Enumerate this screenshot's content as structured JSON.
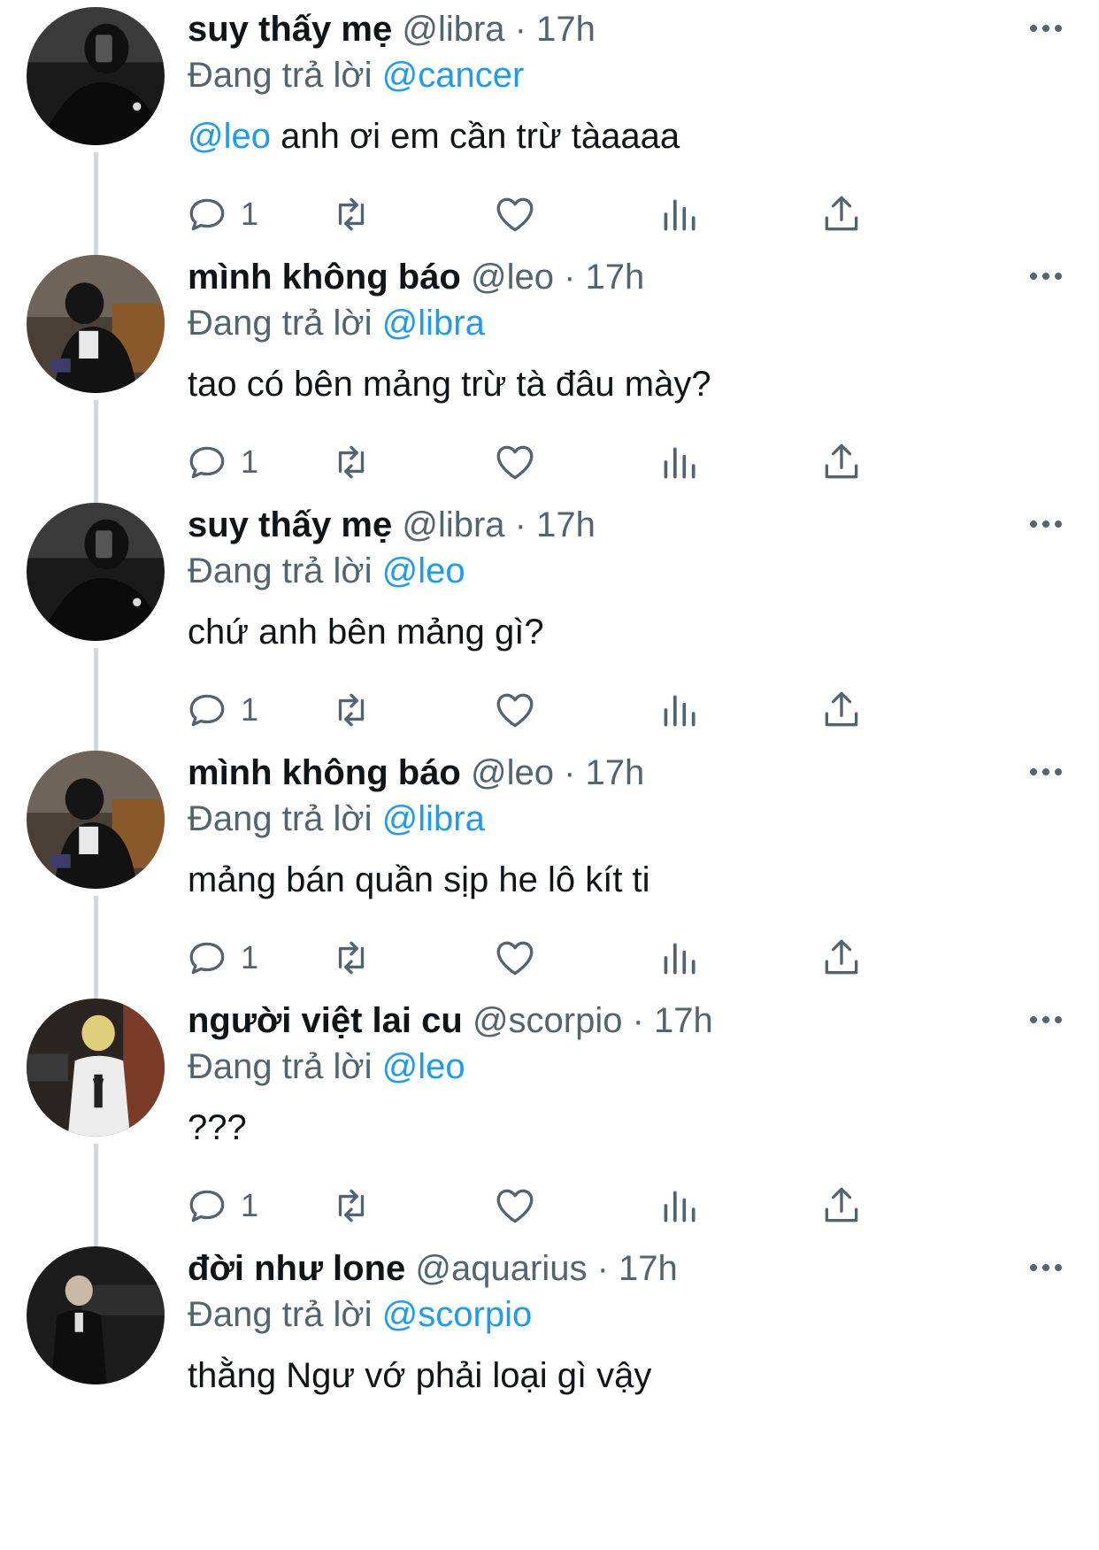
{
  "tweets": [
    {
      "avatar": "mirror-selfie-avatar",
      "name": "suy thấy mẹ",
      "handle": "@libra",
      "time": "17h",
      "reply_label": "Đang trả lời",
      "reply_to": "@cancer",
      "mention": "@leo",
      "text": " anh ơi em cần trừ tàaaaa",
      "reply_count": "1"
    },
    {
      "avatar": "seated-man-avatar",
      "name": "mình không báo",
      "handle": "@leo",
      "time": "17h",
      "reply_label": "Đang trả lời",
      "reply_to": "@libra",
      "mention": "",
      "text": "tao có bên mảng trừ tà đâu mày?",
      "reply_count": "1"
    },
    {
      "avatar": "mirror-selfie-avatar",
      "name": "suy thấy mẹ",
      "handle": "@libra",
      "time": "17h",
      "reply_label": "Đang trả lời",
      "reply_to": "@leo",
      "mention": "",
      "text": "chứ anh bên mảng gì?",
      "reply_count": "1"
    },
    {
      "avatar": "seated-man-avatar",
      "name": "mình không báo",
      "handle": "@leo",
      "time": "17h",
      "reply_label": "Đang trả lời",
      "reply_to": "@libra",
      "mention": "",
      "text": "mảng bán quần sịp he lô kít ti",
      "reply_count": "1"
    },
    {
      "avatar": "blond-man-avatar",
      "name": "người việt lai cu",
      "handle": "@scorpio",
      "time": "17h",
      "reply_label": "Đang trả lời",
      "reply_to": "@leo",
      "mention": "",
      "text": "???",
      "reply_count": "1"
    },
    {
      "avatar": "suited-man-avatar",
      "name": "đời như lone",
      "handle": "@aquarius",
      "time": "17h",
      "reply_label": "Đang trả lời",
      "reply_to": "@scorpio",
      "mention": "",
      "text": "thằng Ngư vớ phải loại gì vậy",
      "reply_count": ""
    }
  ],
  "separator": " · ",
  "icons": {
    "reply": "speech-bubble-icon",
    "retweet": "retweet-arrows-icon",
    "like": "heart-icon",
    "views": "bar-chart-icon",
    "share": "share-upload-icon",
    "more": "more-dots-icon"
  },
  "colors": {
    "link": "#1d9bf0",
    "secondary_text": "#536471",
    "primary_text": "#0f1419",
    "thread_line": "#cfd9de"
  }
}
